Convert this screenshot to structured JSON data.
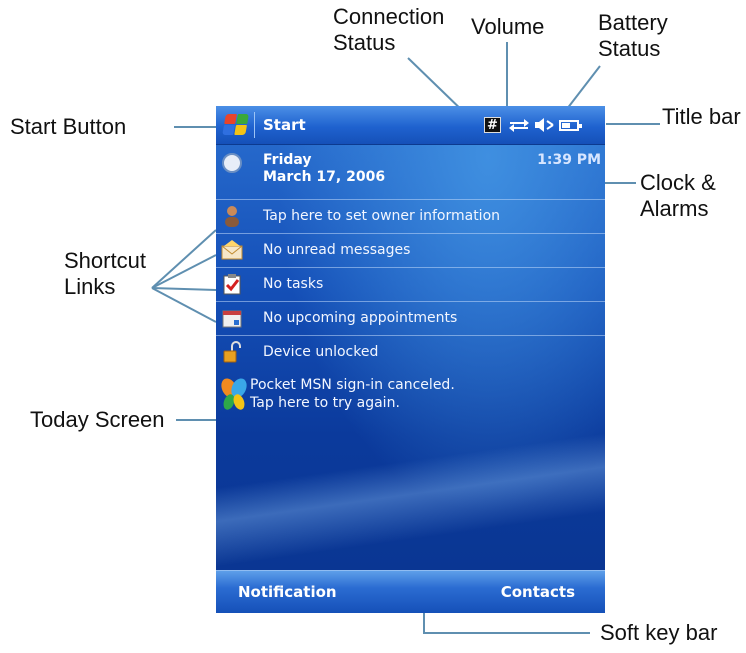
{
  "callouts": {
    "connection_status": "Connection\nStatus",
    "volume": "Volume",
    "battery_status": "Battery\nStatus",
    "start_button": "Start Button",
    "title_bar": "Title bar",
    "clock_alarms": "Clock &\nAlarms",
    "shortcut_links": "Shortcut\nLinks",
    "today_screen": "Today Screen",
    "soft_key_bar": "Soft key bar"
  },
  "device": {
    "title_bar": {
      "start_label": "Start",
      "input_icon_glyph": "#",
      "connection_icon": "connection-arrows-icon",
      "volume_icon": "speaker-muted-icon",
      "battery_icon": "battery-icon",
      "battery_level": 0.6
    },
    "clock": {
      "day": "Friday",
      "date": "March 17, 2006",
      "time": "1:39 PM"
    },
    "items": [
      {
        "icon": "owner-person-icon",
        "label": "Tap here to set owner information"
      },
      {
        "icon": "envelope-icon",
        "label": "No unread messages"
      },
      {
        "icon": "clipboard-check-icon",
        "label": "No tasks"
      },
      {
        "icon": "calendar-icon",
        "label": "No upcoming appointments"
      },
      {
        "icon": "padlock-open-icon",
        "label": "Device unlocked"
      }
    ],
    "msn": {
      "icon": "msn-butterfly-icon",
      "line1": "Pocket MSN sign-in canceled.",
      "line2": "Tap here to try again."
    },
    "softkeys": {
      "left": "Notification",
      "right": "Contacts"
    }
  },
  "colors": {
    "screen_blue": "#1550b8",
    "leader_line": "#5f8fb0",
    "windows_red": "#e8442a",
    "windows_green": "#3aa83a",
    "windows_blue": "#2f6fe0",
    "windows_yellow": "#f3c316"
  }
}
